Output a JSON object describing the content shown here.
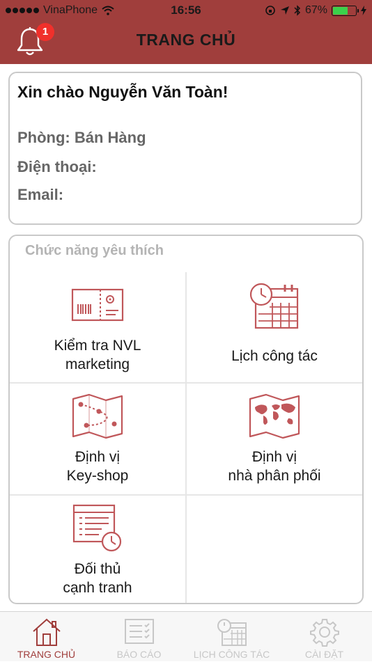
{
  "status_bar": {
    "carrier": "VinaPhone",
    "time": "16:56",
    "battery": "67%",
    "battery_level": 0.67
  },
  "header": {
    "title": "TRANG CHỦ",
    "notification_count": "1"
  },
  "profile": {
    "greeting": "Xin chào Nguyễn Văn Toàn!",
    "department": "Phòng: Bán Hàng",
    "phone": "Điện thoại:",
    "email": "Email:"
  },
  "favorites": {
    "title": "Chức năng yêu thích",
    "items": [
      {
        "line1": "Kiểm tra NVL",
        "line2": "marketing",
        "icon": "ticket-barcode-icon"
      },
      {
        "line1": "Lịch công tác",
        "line2": "",
        "icon": "calendar-clock-icon"
      },
      {
        "line1": "Định vị",
        "line2": "Key-shop",
        "icon": "route-map-icon"
      },
      {
        "line1": "Định vị",
        "line2": "nhà phân phối",
        "icon": "world-map-icon"
      },
      {
        "line1": "Đối thủ",
        "line2": "cạnh tranh",
        "icon": "document-clock-icon"
      }
    ]
  },
  "tabs": [
    {
      "label": "TRANG CHỦ",
      "icon": "home-icon",
      "active": true
    },
    {
      "label": "BÁO CÁO",
      "icon": "checklist-icon",
      "active": false
    },
    {
      "label": "LỊCH CÔNG TÁC",
      "icon": "calendar-clock-icon",
      "active": false
    },
    {
      "label": "CÀI ĐẶT",
      "icon": "gear-icon",
      "active": false
    }
  ],
  "colors": {
    "brand": "#a03e3c",
    "icon_stroke": "#c0575a",
    "badge": "#f0302b",
    "inactive_tab": "#c7c7c7"
  }
}
